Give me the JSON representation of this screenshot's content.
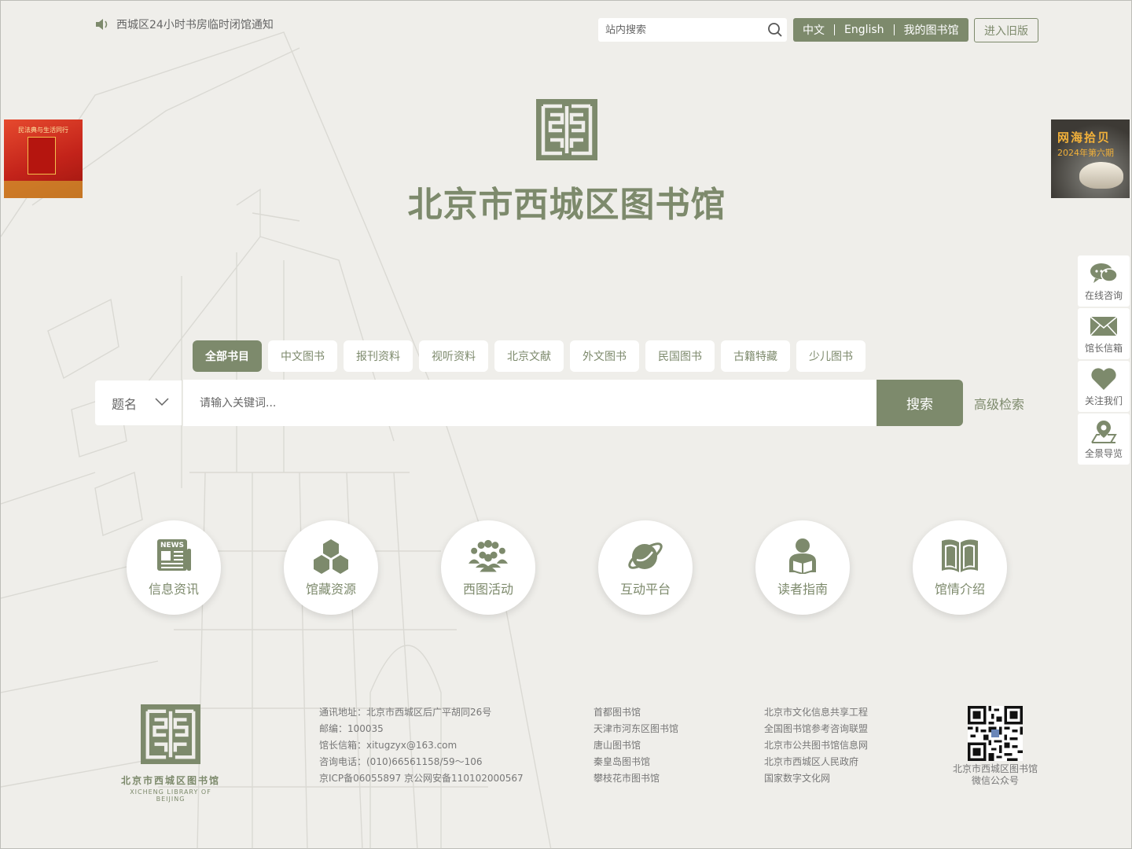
{
  "top": {
    "notice": "西城区24小时书房临时闭馆通知",
    "site_search_placeholder": "站内搜索",
    "lang_cn": "中文",
    "lang_en": "English",
    "my_library": "我的图书馆",
    "old_version": "进入旧版"
  },
  "brand": {
    "title": "北京市西城区图书馆"
  },
  "ads": {
    "left_caption": "民法典与生活同行",
    "right_title": "网海拾贝",
    "right_subtitle": "2024年第六期"
  },
  "categories": [
    "全部书目",
    "中文图书",
    "报刊资料",
    "视听资料",
    "北京文献",
    "外文图书",
    "民国图书",
    "古籍特藏",
    "少儿图书"
  ],
  "search": {
    "field": "题名",
    "placeholder": "请输入关键词...",
    "button": "搜索",
    "advanced": "高级检索"
  },
  "sidebar": [
    {
      "label": "在线咨询",
      "icon": "chat-icon"
    },
    {
      "label": "馆长信箱",
      "icon": "mail-icon"
    },
    {
      "label": "关注我们",
      "icon": "heart-icon"
    },
    {
      "label": "全景导览",
      "icon": "location-icon"
    }
  ],
  "nav": [
    {
      "label": "信息资讯",
      "icon": "news-icon",
      "badge": "NEWS"
    },
    {
      "label": "馆藏资源",
      "icon": "cubes-icon"
    },
    {
      "label": "西图活动",
      "icon": "people-icon"
    },
    {
      "label": "互动平台",
      "icon": "planet-icon"
    },
    {
      "label": "读者指南",
      "icon": "reader-icon"
    },
    {
      "label": "馆情介绍",
      "icon": "book-icon"
    }
  ],
  "footer": {
    "logo_cn": "北京市西城区图书馆",
    "logo_en": "XICHENG LIBRARY OF BEIJING",
    "contact": [
      "通讯地址：北京市西城区后广平胡同26号",
      "邮编：100035",
      "馆长信箱：xitugzyx@163.com",
      "咨询电话：(010)66561158/59～106",
      "京ICP备06055897 京公网安备110102000567"
    ],
    "links1": [
      "首都图书馆",
      "天津市河东区图书馆",
      "唐山图书馆",
      "秦皇岛图书馆",
      "攀枝花市图书馆"
    ],
    "links2": [
      "北京市文化信息共享工程",
      "全国图书馆参考咨询联盟",
      "北京市公共图书馆信息网",
      "北京市西城区人民政府",
      "国家数字文化网"
    ],
    "qr_line1": "北京市西城区图书馆",
    "qr_line2": "微信公众号"
  },
  "colors": {
    "accent": "#7d8a6c",
    "background": "#efeeea"
  }
}
